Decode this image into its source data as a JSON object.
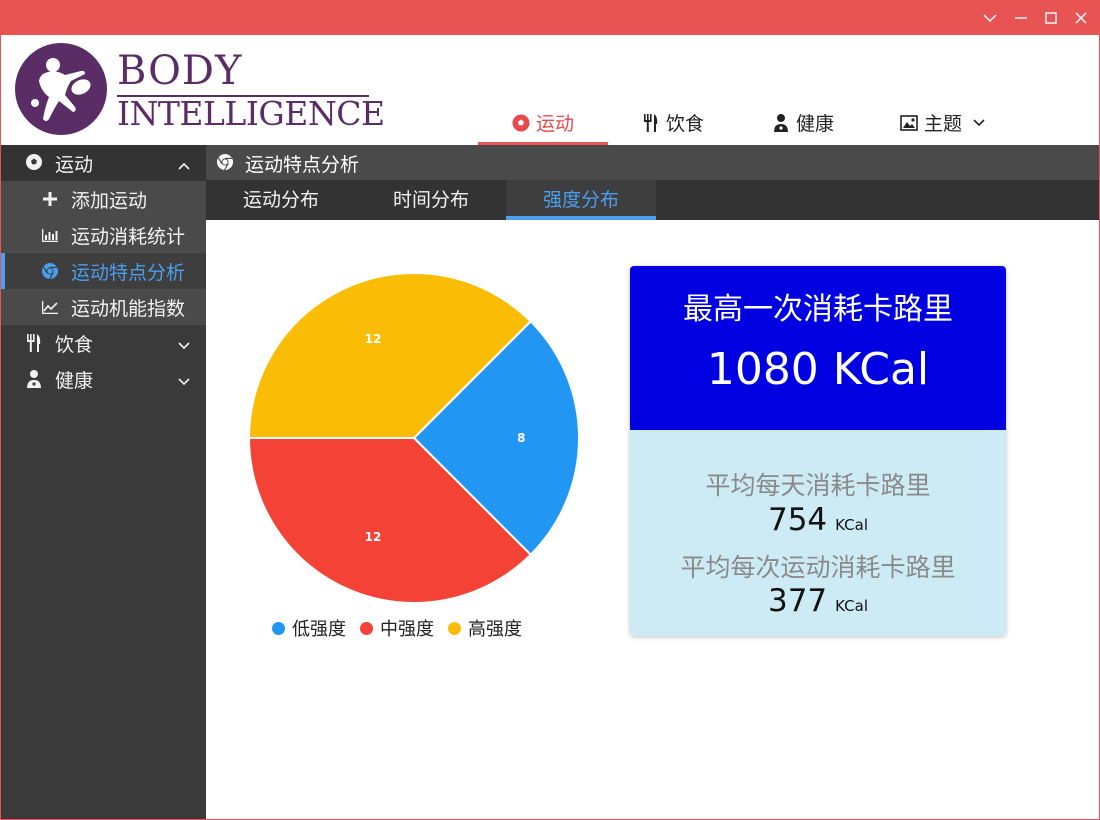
{
  "window": {
    "accent_color": "#e85454"
  },
  "brand": {
    "line1": "BODY",
    "line2": "INTELLIGENCE",
    "color": "#5a2d66"
  },
  "topnav": {
    "items": [
      {
        "label": "运动",
        "icon": "soccer-ball-icon",
        "active": true
      },
      {
        "label": "饮食",
        "icon": "fork-knife-icon",
        "active": false
      },
      {
        "label": "健康",
        "icon": "doctor-icon",
        "active": false
      },
      {
        "label": "主题",
        "icon": "image-icon",
        "active": false,
        "has_dropdown": true
      }
    ]
  },
  "sidebar": {
    "groups": [
      {
        "label": "运动",
        "icon": "soccer-ball-icon",
        "expanded": true
      },
      {
        "label": "饮食",
        "icon": "fork-knife-icon",
        "expanded": false
      },
      {
        "label": "健康",
        "icon": "doctor-icon",
        "expanded": false
      }
    ],
    "items": [
      {
        "label": "添加运动",
        "icon": "plus-icon"
      },
      {
        "label": "运动消耗统计",
        "icon": "bar-chart-icon"
      },
      {
        "label": "运动特点分析",
        "icon": "chrome-icon",
        "active": true
      },
      {
        "label": "运动机能指数",
        "icon": "line-chart-icon"
      }
    ]
  },
  "page": {
    "title": "运动特点分析",
    "tabs": [
      {
        "label": "运动分布"
      },
      {
        "label": "时间分布"
      },
      {
        "label": "强度分布",
        "active": true
      }
    ]
  },
  "chart_data": {
    "type": "pie",
    "categories": [
      "低强度",
      "中强度",
      "高强度"
    ],
    "values": [
      8,
      12,
      12
    ],
    "colors": [
      "#2196f3",
      "#f44336",
      "#fbbc05"
    ],
    "legend_position": "bottom"
  },
  "stats": {
    "max_title": "最高一次消耗卡路里",
    "max_value": "1080 KCal",
    "avg_day_title": "平均每天消耗卡路里",
    "avg_day_value": "754",
    "avg_session_title": "平均每次运动消耗卡路里",
    "avg_session_value": "377",
    "unit": "KCal"
  }
}
